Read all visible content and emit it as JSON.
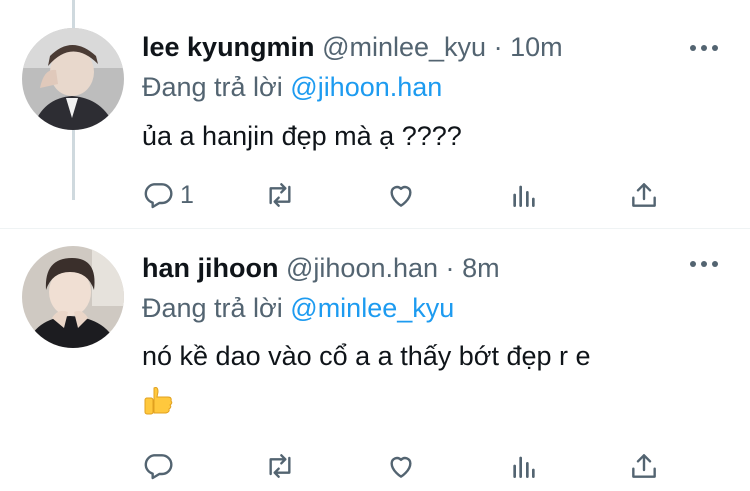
{
  "tweets": [
    {
      "name": "lee kyungmin",
      "handle": "@minlee_kyu",
      "separator": "·",
      "time": "10m",
      "replying_prefix": "Đang trả lời",
      "replying_to": "@jihoon.han",
      "text": "ủa a hanjin đẹp mà ạ ????",
      "reply_count": "1"
    },
    {
      "name": "han jihoon",
      "handle": "@jihoon.han",
      "separator": "·",
      "time": "8m",
      "replying_prefix": "Đang trả lời",
      "replying_to": "@minlee_kyu",
      "text": "nó kề dao vào cổ a a thấy bớt đẹp r e",
      "emoji_icon": "thumbs-up-icon",
      "reply_count": ""
    }
  ],
  "icons": [
    "reply-icon",
    "retweet-icon",
    "like-icon",
    "analytics-icon",
    "share-icon",
    "more-icon"
  ],
  "colors": {
    "text": "#0f1419",
    "secondary": "#536471",
    "link": "#1d9bf0",
    "thread_line": "#cfd9de"
  }
}
